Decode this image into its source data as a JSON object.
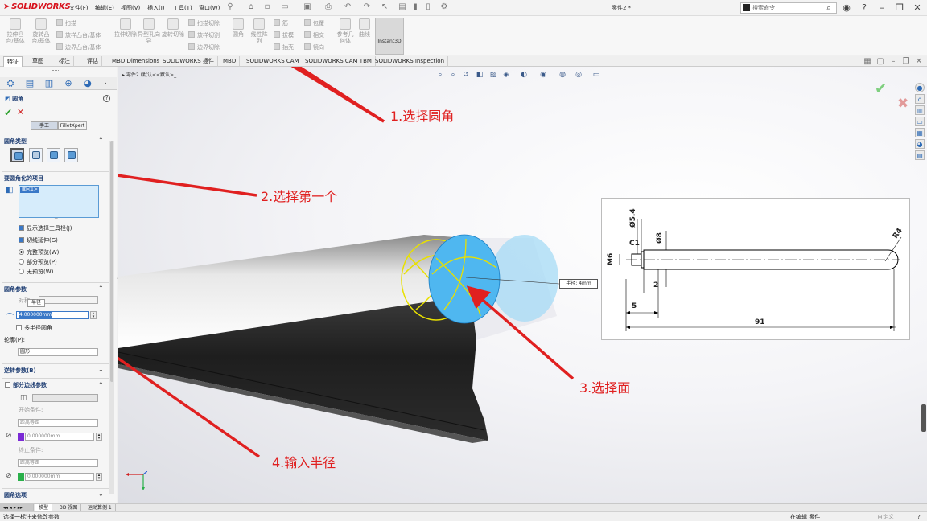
{
  "app": {
    "logo": "SOLIDWORKS",
    "doc_title": "零件2 *",
    "search_placeholder": "搜索命令"
  },
  "menus": [
    "文件(F)",
    "编辑(E)",
    "视图(V)",
    "插入(I)",
    "工具(T)",
    "窗口(W)"
  ],
  "ribbon": {
    "left_buttons": [
      {
        "label": "拉伸凸台/基体",
        "icon": "extruded-boss-icon"
      },
      {
        "label": "旋转凸台/基体",
        "icon": "revolved-boss-icon"
      }
    ],
    "boss_small": [
      "扫描",
      "放样凸台/基体",
      "边界凸台/基体"
    ],
    "cut_buttons": [
      {
        "label": "拉伸切除",
        "icon": "extruded-cut-icon"
      },
      {
        "label": "异型孔向导",
        "icon": "hole-wizard-icon"
      },
      {
        "label": "旋转切除",
        "icon": "revolved-cut-icon"
      }
    ],
    "cut_small": [
      "扫描切除",
      "放样切割",
      "边界切除"
    ],
    "fillet_button": {
      "label": "圆角",
      "icon": "fillet-icon"
    },
    "pattern_button": {
      "label": "线性阵列",
      "icon": "linear-pattern-icon"
    },
    "mid_small_a": [
      "筋",
      "拔模",
      "抽壳"
    ],
    "mid_small_b": [
      "包覆",
      "相交",
      "镜向"
    ],
    "ref_button": {
      "label": "参考几何体",
      "icon": "reference-geometry-icon"
    },
    "curves_button": {
      "label": "曲线",
      "icon": "curves-icon"
    },
    "instant3d": "Instant3D"
  },
  "cmd_tabs": [
    "特征",
    "草图",
    "标注",
    "评估",
    "MBD Dimensions",
    "SOLIDWORKS 插件",
    "MBD",
    "SOLIDWORKS CAM",
    "SOLIDWORKS CAM TBM",
    "SOLIDWORKS Inspection"
  ],
  "pm": {
    "title": "圆角",
    "mode_manual": "手工",
    "mode_xpert": "FilletXpert",
    "sec_type": "圆角类型",
    "sec_items": "要圆角化的项目",
    "list_item": "面<1>",
    "checks": [
      {
        "label": "显示选择工具栏(J)",
        "checked": true,
        "kind": "check"
      },
      {
        "label": "切线延伸(G)",
        "checked": true,
        "kind": "check"
      },
      {
        "label": "完整预览(W)",
        "checked": true,
        "kind": "radio"
      },
      {
        "label": "部分预览(P)",
        "checked": false,
        "kind": "radio"
      },
      {
        "label": "无预览(W)",
        "checked": false,
        "kind": "radio"
      }
    ],
    "sec_params": "圆角参数",
    "symmetric_label": "对称",
    "tooltip": "半径",
    "radius_value": "4.000000mm",
    "multi_radius": "多半径圆角",
    "profile_label": "轮廓(P):",
    "profile_value": "圆形",
    "sec_reverse": "逆转参数(B)",
    "sec_partial": "部分边线参数",
    "start_condition": "开始条件:",
    "start_value": "距离等距",
    "start_offset": "0.000000mm",
    "end_condition": "终止条件:",
    "end_value": "距离等距",
    "end_offset": "0.000000mm",
    "sec_options": "圆角选项",
    "colors": {
      "start": "#7b2ad6",
      "end": "#2ab04a"
    }
  },
  "viewport": {
    "crumb": "零件2 (默认<<默认>_...",
    "callout": "半径: 4mm",
    "annotations": [
      "1.选择圆角",
      "2.选择第一个",
      "3.选择面",
      "4.输入半径"
    ],
    "annotation_color": "#e02020",
    "drawing": {
      "dims": [
        "Ø5.4",
        "Ø8",
        "R4",
        "C1",
        "M6",
        "2",
        "5",
        "91"
      ]
    }
  },
  "bottom_tabs": [
    "模型",
    "3D 视图",
    "运动算例 1"
  ],
  "status": {
    "left": "选择一标注来修改参数",
    "editing": "在编辑 零件",
    "units": "自定义"
  }
}
